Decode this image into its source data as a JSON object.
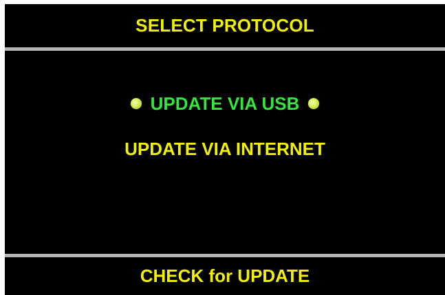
{
  "header": {
    "title": "SELECT PROTOCOL"
  },
  "menu": {
    "items": [
      {
        "label": "UPDATE VIA USB",
        "selected": true
      },
      {
        "label": "UPDATE VIA INTERNET",
        "selected": false
      }
    ]
  },
  "footer": {
    "action_label": "CHECK for UPDATE"
  },
  "colors": {
    "background": "#000000",
    "text_default": "#f2f200",
    "text_selected": "#33e63b",
    "divider": "#b5b5b5",
    "selection_dot": "#d6ee55"
  },
  "icons": {
    "selection_marker": "selection-dot-icon"
  }
}
